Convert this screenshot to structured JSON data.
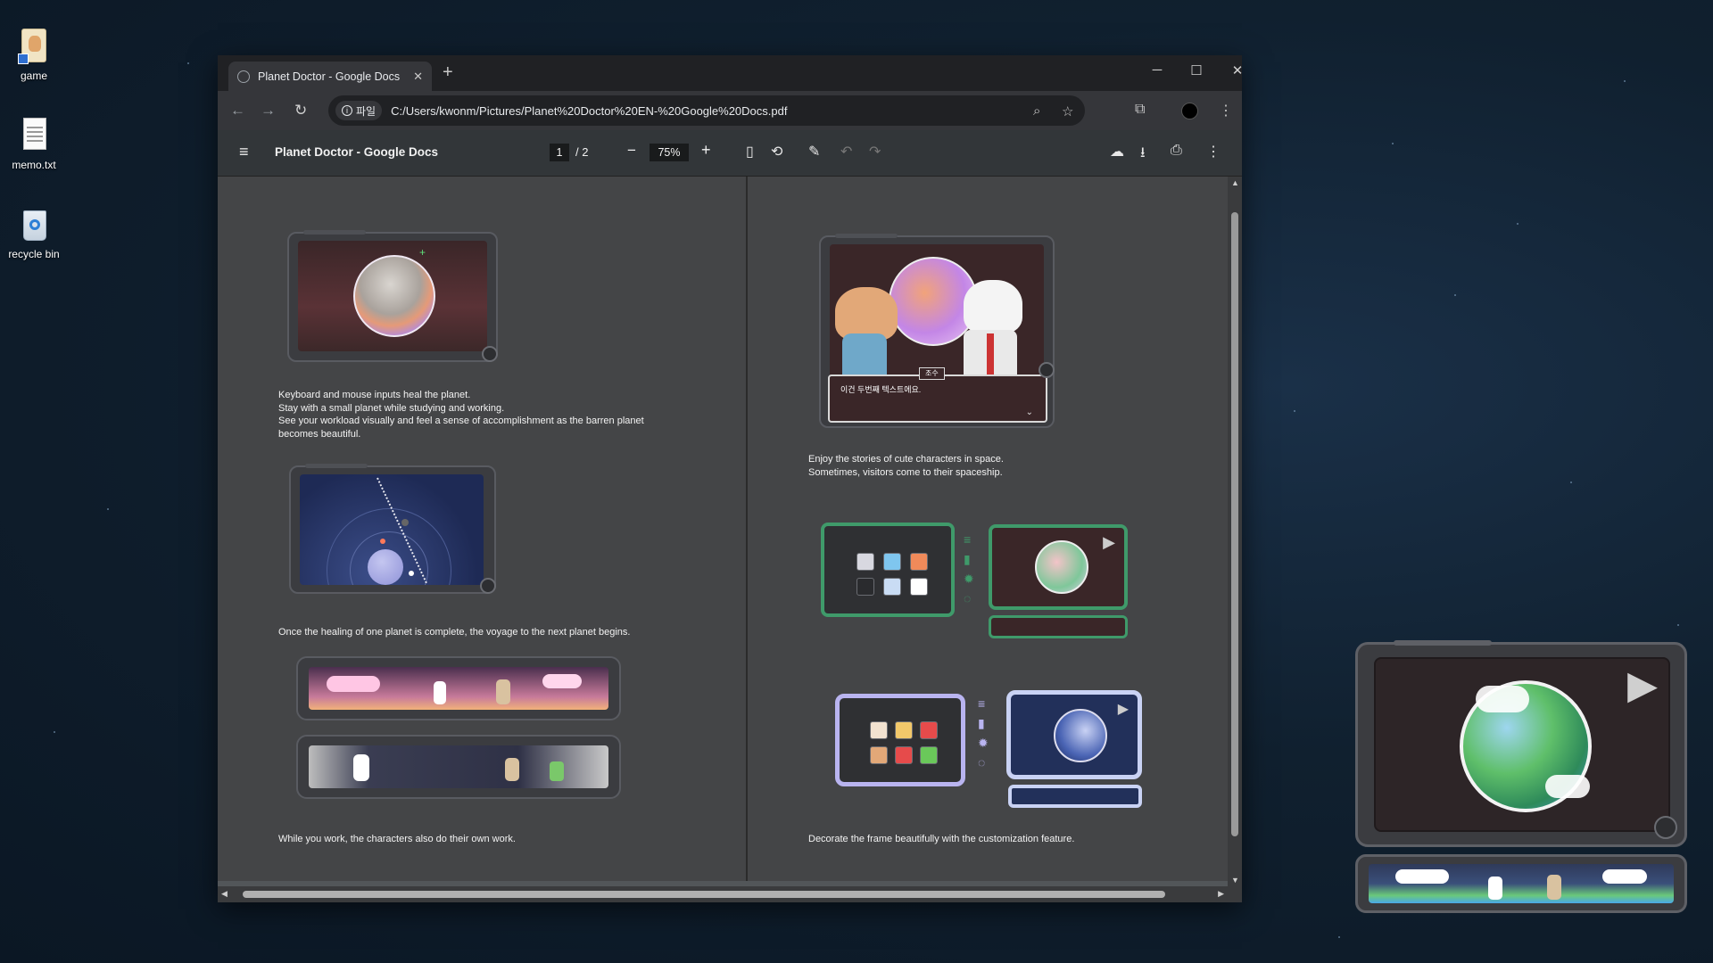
{
  "desktop": {
    "icons": [
      {
        "label": "game",
        "icon": "game-shortcut-icon"
      },
      {
        "label": "memo.txt",
        "icon": "text-file-icon"
      },
      {
        "label": "recycle bin",
        "icon": "recycle-bin-icon"
      }
    ]
  },
  "browser": {
    "tab_title": "Planet Doctor - Google Docs",
    "new_tab": "+",
    "window_controls": {
      "minimize": "─",
      "maximize": "☐",
      "close": "✕"
    },
    "nav": {
      "back": "←",
      "forward": "→",
      "reload": "↻"
    },
    "omnibox": {
      "chip_label": "파일",
      "url": "C:/Users/kwonm/Pictures/Planet%20Doctor%20EN-%20Google%20Docs.pdf"
    }
  },
  "pdf_toolbar": {
    "title": "Planet Doctor - Google Docs",
    "current_page": "1",
    "page_total": "/  2",
    "zoom": "75%"
  },
  "page1": {
    "text1": [
      "Keyboard and mouse inputs heal the planet.",
      "Stay with a small planet while studying and working.",
      "See your workload visually and feel a sense of accomplishment as the barren planet",
      "becomes beautiful."
    ],
    "text2": "Once the healing of one planet is complete, the voyage to the next planet begins.",
    "text3": "While you work, the characters also do their own work."
  },
  "page2": {
    "dialog_name": "조수",
    "dialog_text": "이건 두번째 텍스트에요.",
    "text1": [
      "Enjoy the stories of cute characters in space.",
      "Sometimes, visitors come to their spaceship."
    ],
    "text2": "Decorate the frame beautifully with the customization feature."
  },
  "colors": {
    "desktop_bg": "#10202f",
    "pdf_page": "#444547",
    "accent_green": "#3f9a6a",
    "frame_lavender": "#b9b4f0"
  }
}
